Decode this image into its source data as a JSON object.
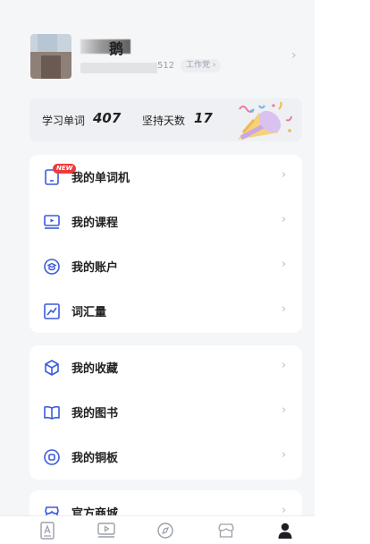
{
  "profile": {
    "nickname_visible": "鹅",
    "id_tail": "512",
    "tag": "工作党 ›"
  },
  "stats": {
    "words_label": "学习单词",
    "words_value": "407",
    "days_label": "坚持天数",
    "days_value": "17"
  },
  "menu_group1": [
    {
      "label": "我的单词机",
      "icon": "word-device-icon",
      "badge": "NEW"
    },
    {
      "label": "我的课程",
      "icon": "course-play-icon"
    },
    {
      "label": "我的账户",
      "icon": "account-icon"
    },
    {
      "label": "词汇量",
      "icon": "vocabulary-chart-icon"
    }
  ],
  "menu_group2": [
    {
      "label": "我的收藏",
      "icon": "box-icon"
    },
    {
      "label": "我的图书",
      "icon": "book-icon"
    },
    {
      "label": "我的铜板",
      "icon": "coin-icon"
    }
  ],
  "menu_group3": [
    {
      "label": "官方商城",
      "icon": "shop-icon"
    }
  ],
  "chevron": "›",
  "bottom_nav": [
    {
      "icon": "word-tab-icon",
      "active": false
    },
    {
      "icon": "video-tab-icon",
      "active": false
    },
    {
      "icon": "discover-tab-icon",
      "active": false
    },
    {
      "icon": "store-tab-icon",
      "active": false
    },
    {
      "icon": "profile-tab-icon",
      "active": true
    }
  ],
  "colors": {
    "background": "#f5f6f8",
    "accent_blue": "#3b5bdb",
    "badge_red": "#ee3b3b",
    "text_dark": "#222222",
    "text_grey": "#9aa0a8"
  }
}
